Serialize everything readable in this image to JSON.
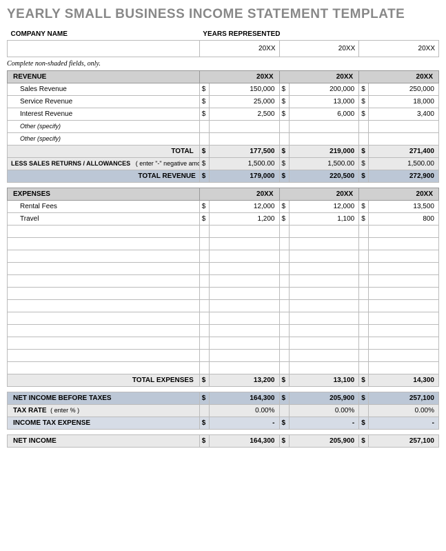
{
  "title": "YEARLY SMALL BUSINESS INCOME STATEMENT TEMPLATE",
  "header": {
    "company_label": "COMPANY NAME",
    "years_label": "YEARS REPRESENTED",
    "company_value": "",
    "year1": "20XX",
    "year2": "20XX",
    "year3": "20XX"
  },
  "note": "Complete non-shaded fields, only.",
  "revenue": {
    "label": "REVENUE",
    "y1": "20XX",
    "y2": "20XX",
    "y3": "20XX",
    "rows": [
      {
        "label": "Sales Revenue",
        "v1": "150,000",
        "v2": "200,000",
        "v3": "250,000"
      },
      {
        "label": "Service Revenue",
        "v1": "25,000",
        "v2": "13,000",
        "v3": "18,000"
      },
      {
        "label": "Interest Revenue",
        "v1": "2,500",
        "v2": "6,000",
        "v3": "3,400"
      },
      {
        "label": "Other (specify)",
        "v1": "",
        "v2": "",
        "v3": "",
        "italic": true
      },
      {
        "label": "Other (specify)",
        "v1": "",
        "v2": "",
        "v3": "",
        "italic": true
      }
    ],
    "total_label": "TOTAL",
    "total": {
      "v1": "177,500",
      "v2": "219,000",
      "v3": "271,400"
    },
    "allow_label": "LESS SALES RETURNS / ALLOWANCES",
    "allow_hint": "( enter \"-\" negative amount )",
    "allow": {
      "v1": "1,500.00",
      "v2": "1,500.00",
      "v3": "1,500.00"
    },
    "revenue_total_label": "TOTAL REVENUE",
    "revenue_total": {
      "v1": "179,000",
      "v2": "220,500",
      "v3": "272,900"
    }
  },
  "expenses": {
    "label": "EXPENSES",
    "y1": "20XX",
    "y2": "20XX",
    "y3": "20XX",
    "rows": [
      {
        "label": "Rental Fees",
        "v1": "12,000",
        "v2": "12,000",
        "v3": "13,500"
      },
      {
        "label": "Travel",
        "v1": "1,200",
        "v2": "1,100",
        "v3": "800"
      },
      {
        "label": "",
        "v1": "",
        "v2": "",
        "v3": ""
      },
      {
        "label": "",
        "v1": "",
        "v2": "",
        "v3": ""
      },
      {
        "label": "",
        "v1": "",
        "v2": "",
        "v3": ""
      },
      {
        "label": "",
        "v1": "",
        "v2": "",
        "v3": ""
      },
      {
        "label": "",
        "v1": "",
        "v2": "",
        "v3": ""
      },
      {
        "label": "",
        "v1": "",
        "v2": "",
        "v3": ""
      },
      {
        "label": "",
        "v1": "",
        "v2": "",
        "v3": ""
      },
      {
        "label": "",
        "v1": "",
        "v2": "",
        "v3": ""
      },
      {
        "label": "",
        "v1": "",
        "v2": "",
        "v3": ""
      },
      {
        "label": "",
        "v1": "",
        "v2": "",
        "v3": ""
      },
      {
        "label": "",
        "v1": "",
        "v2": "",
        "v3": ""
      },
      {
        "label": "",
        "v1": "",
        "v2": "",
        "v3": ""
      }
    ],
    "total_label": "TOTAL EXPENSES",
    "total": {
      "v1": "13,200",
      "v2": "13,100",
      "v3": "14,300"
    }
  },
  "summary": {
    "before_tax_label": "NET INCOME BEFORE TAXES",
    "before_tax": {
      "v1": "164,300",
      "v2": "205,900",
      "v3": "257,100"
    },
    "tax_rate_label": "TAX RATE",
    "tax_rate_hint": "( enter % )",
    "tax_rate": {
      "v1": "0.00%",
      "v2": "0.00%",
      "v3": "0.00%"
    },
    "tax_expense_label": "INCOME TAX EXPENSE",
    "tax_expense": {
      "v1": "-",
      "v2": "-",
      "v3": "-"
    },
    "net_label": "NET INCOME",
    "net": {
      "v1": "164,300",
      "v2": "205,900",
      "v3": "257,100"
    }
  },
  "currency": "$"
}
